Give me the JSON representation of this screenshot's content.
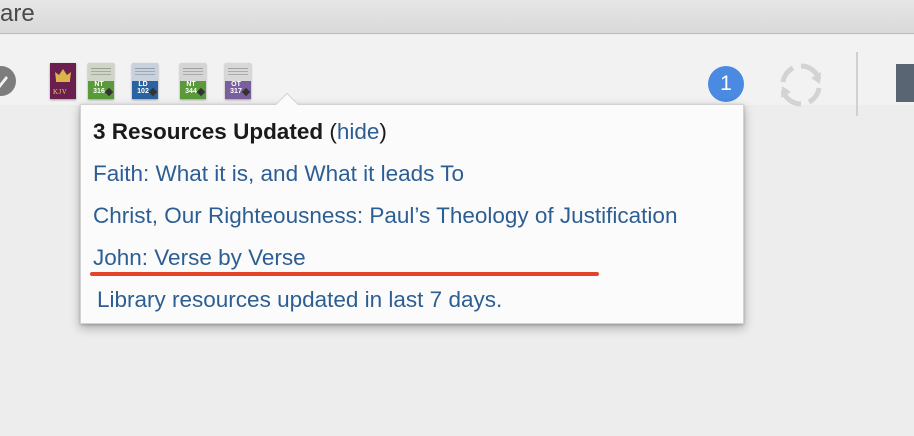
{
  "window": {
    "title_fragment": "are"
  },
  "toolbar": {
    "resources": [
      {
        "name": "kjv-book-icon",
        "label": "KJV",
        "color": "#6b1f4e"
      },
      {
        "name": "nt316-book-icon",
        "label": "NT 316",
        "color": "#5a9a3a"
      },
      {
        "name": "ld102-book-icon",
        "label": "LD 102",
        "color": "#2a63a0"
      },
      {
        "name": "nt344-book-icon",
        "label": "NT 344",
        "color": "#5a9a3a"
      },
      {
        "name": "ot317-book-icon",
        "label": "OT 317",
        "color": "#7a5f9e"
      }
    ],
    "notification_count": "1",
    "sync_icon": "sync-icon",
    "edit_icon": "pencil-icon"
  },
  "popup": {
    "heading": "3 Resources Updated",
    "hide_open": "(",
    "hide_label": "hide",
    "hide_close": ")",
    "items": [
      "Faith: What it is, and What it leads To",
      "Christ, Our Righteousness: Paul’s Theology of Justification",
      "John: Verse by Verse"
    ],
    "footer": "Library resources updated in last 7 days."
  },
  "colors": {
    "link": "#2d5e93",
    "badge": "#4a8ae0",
    "highlight_underline": "#e2432a"
  }
}
